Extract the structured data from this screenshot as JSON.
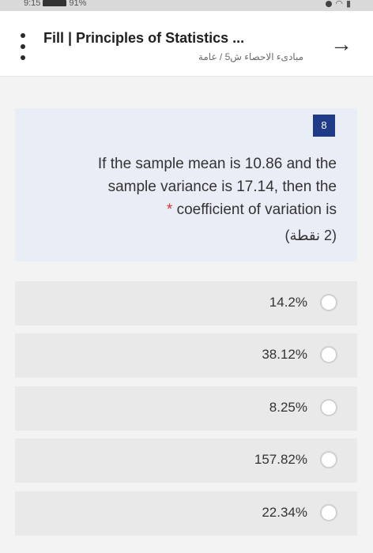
{
  "status": {
    "time": "9:15",
    "battery": "91%"
  },
  "header": {
    "title": "Fill | Principles of Statistics ...",
    "subtitle": "مبادىء الاحصاء ش5 / عامة"
  },
  "question": {
    "number": "8",
    "text_line1": "If the sample mean is 10.86 and the",
    "text_line2": "sample variance is 17.14, then the",
    "required_mark": "*",
    "text_line3": "coefficient of variation is",
    "points": "(2 نقطة)"
  },
  "options": [
    {
      "label": "14.2%"
    },
    {
      "label": "38.12%"
    },
    {
      "label": "8.25%"
    },
    {
      "label": "157.82%"
    },
    {
      "label": "22.34%"
    }
  ]
}
